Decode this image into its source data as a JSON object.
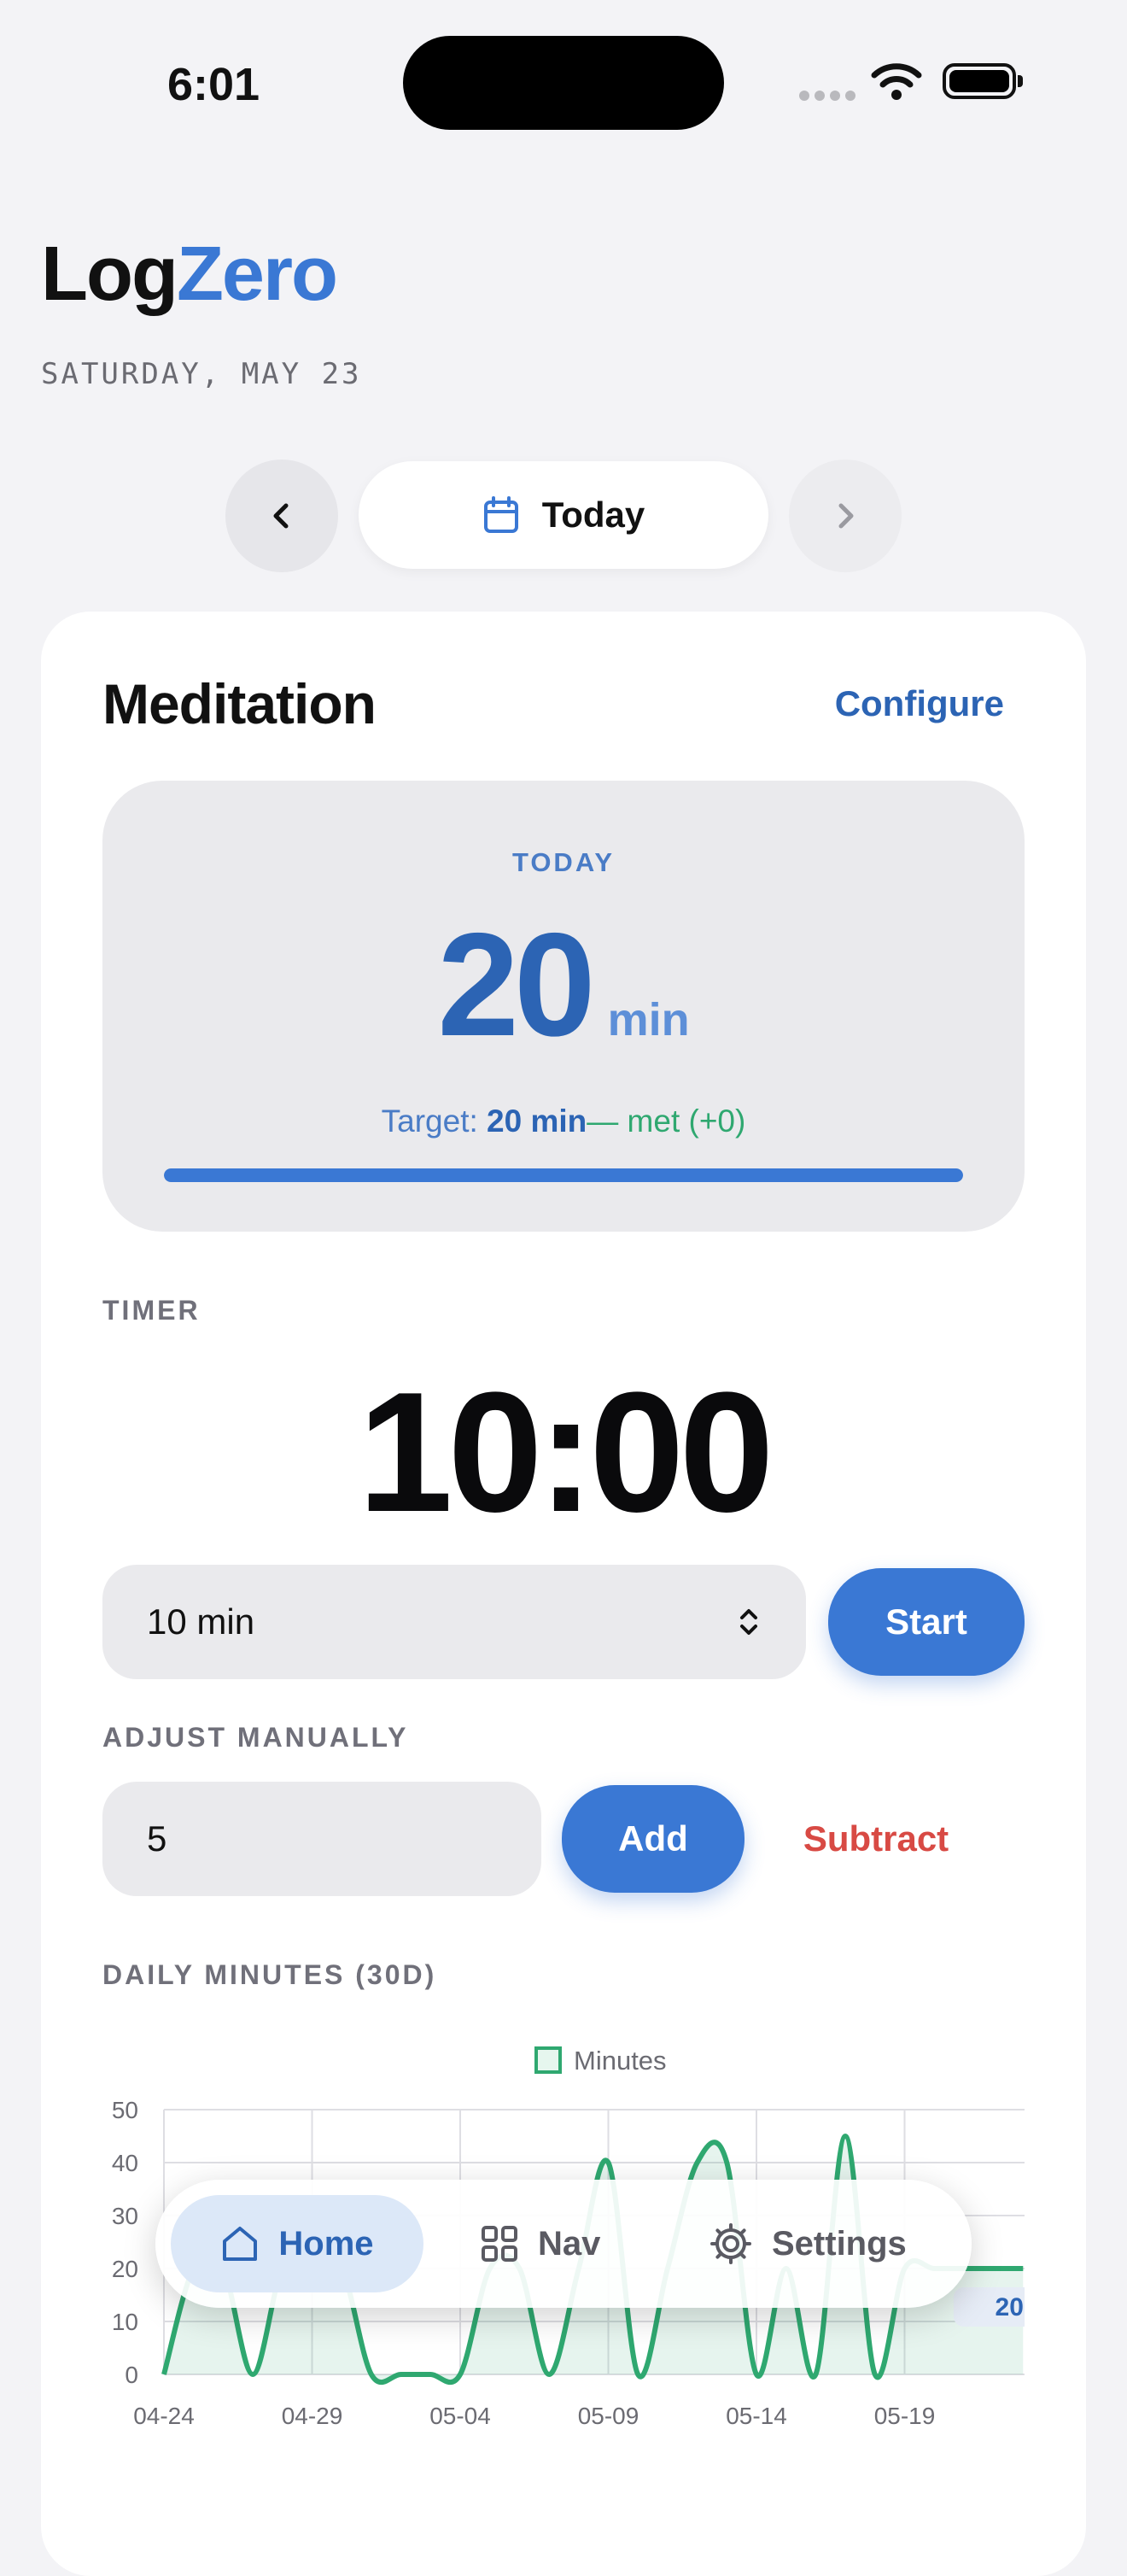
{
  "status_bar": {
    "time": "6:01"
  },
  "header": {
    "title_part1": "Log",
    "title_part2": "Zero",
    "date": "SATURDAY, MAY 23"
  },
  "date_nav": {
    "label": "Today"
  },
  "card": {
    "title": "Meditation",
    "configure_label": "Configure",
    "today": {
      "label": "TODAY",
      "value": "20",
      "unit": "min",
      "target_prefix": "Target: ",
      "target_value": "20 min",
      "target_status": "— met (+0)",
      "progress_fraction": 1.0
    },
    "timer": {
      "label": "TIMER",
      "display": "10:00",
      "duration_selected": "10 min",
      "start_label": "Start"
    },
    "adjust": {
      "label": "ADJUST MANUALLY",
      "input_value": "5",
      "add_label": "Add",
      "subtract_label": "Subtract"
    },
    "chart_section_label": "DAILY MINUTES (30D)"
  },
  "chart_data": {
    "type": "line",
    "legend": [
      "Minutes"
    ],
    "x": [
      "04-24",
      "04-25",
      "04-26",
      "04-27",
      "04-28",
      "04-29",
      "04-30",
      "05-01",
      "05-02",
      "05-03",
      "05-04",
      "05-05",
      "05-06",
      "05-07",
      "05-08",
      "05-09",
      "05-10",
      "05-11",
      "05-12",
      "05-13",
      "05-14",
      "05-15",
      "05-16",
      "05-17",
      "05-18",
      "05-19",
      "05-20",
      "05-21",
      "05-22",
      "05-23"
    ],
    "x_tick_labels": [
      "04-24",
      "04-29",
      "05-04",
      "05-09",
      "05-14",
      "05-19"
    ],
    "series": [
      {
        "name": "Minutes",
        "values": [
          0,
          20,
          20,
          0,
          20,
          20,
          20,
          0,
          0,
          0,
          0,
          20,
          20,
          0,
          20,
          40,
          0,
          20,
          40,
          40,
          0,
          20,
          0,
          45,
          0,
          20,
          20,
          20,
          20,
          20
        ]
      }
    ],
    "y_ticks": [
      0,
      10,
      20,
      30,
      40,
      50
    ],
    "ylim": [
      0,
      50
    ],
    "tooltip_value": "20",
    "line_color": "#2fa870"
  },
  "bottom_nav": {
    "items": [
      {
        "label": "Home",
        "icon": "home-icon",
        "active": true
      },
      {
        "label": "Nav",
        "icon": "grid-icon",
        "active": false
      },
      {
        "label": "Settings",
        "icon": "gear-icon",
        "active": false
      }
    ]
  }
}
